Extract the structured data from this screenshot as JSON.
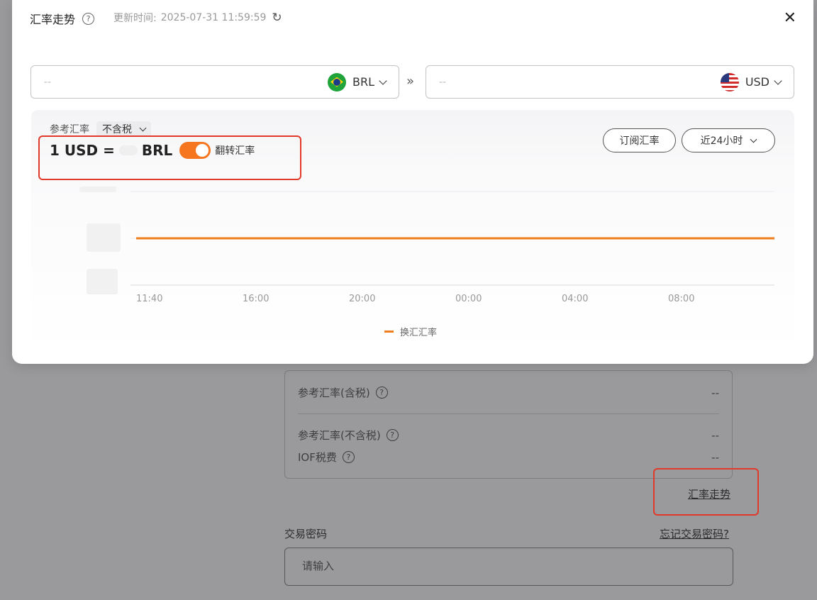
{
  "background": {
    "rate_box": {
      "rows": [
        {
          "label": "参考汇率(含税)",
          "value": "--"
        },
        {
          "label": "参考汇率(不含税)",
          "value": "--"
        },
        {
          "label": "IOF税费",
          "value": "--"
        }
      ]
    },
    "trend_link": "汇率走势",
    "password_label": "交易密码",
    "forgot_password": "忘记交易密码?",
    "password_placeholder": "请输入"
  },
  "modal": {
    "title": "汇率走势",
    "help_icon": "?",
    "update_label": "更新时间:",
    "update_time": "2025-07-31 11:59:59",
    "refresh_icon": "↻",
    "close_icon": "✕",
    "from": {
      "amount": "--",
      "currency": "BRL",
      "flag": "brazil-flag-icon"
    },
    "swap_icon": "»",
    "to": {
      "amount": "--",
      "currency": "USD",
      "flag": "usa-flag-icon"
    },
    "ref_rate_label": "参考汇率",
    "tax_option": "不含税",
    "rate_prefix": "1 USD =",
    "rate_suffix": "BRL",
    "invert_label": "翻转汇率",
    "invert_on": true,
    "subscribe_label": "订阅汇率",
    "range_label": "近24小时",
    "accent_color": "#f5761f"
  },
  "chart_data": {
    "type": "line",
    "x": [
      "11:40",
      "16:00",
      "20:00",
      "00:00",
      "04:00",
      "08:00"
    ],
    "series": [
      {
        "name": "换汇汇率",
        "values": [
          null,
          null,
          null,
          null,
          null,
          null
        ],
        "trend": "flat"
      }
    ],
    "grid": true,
    "legend": "bottom-center",
    "color": "#f07d1c"
  }
}
